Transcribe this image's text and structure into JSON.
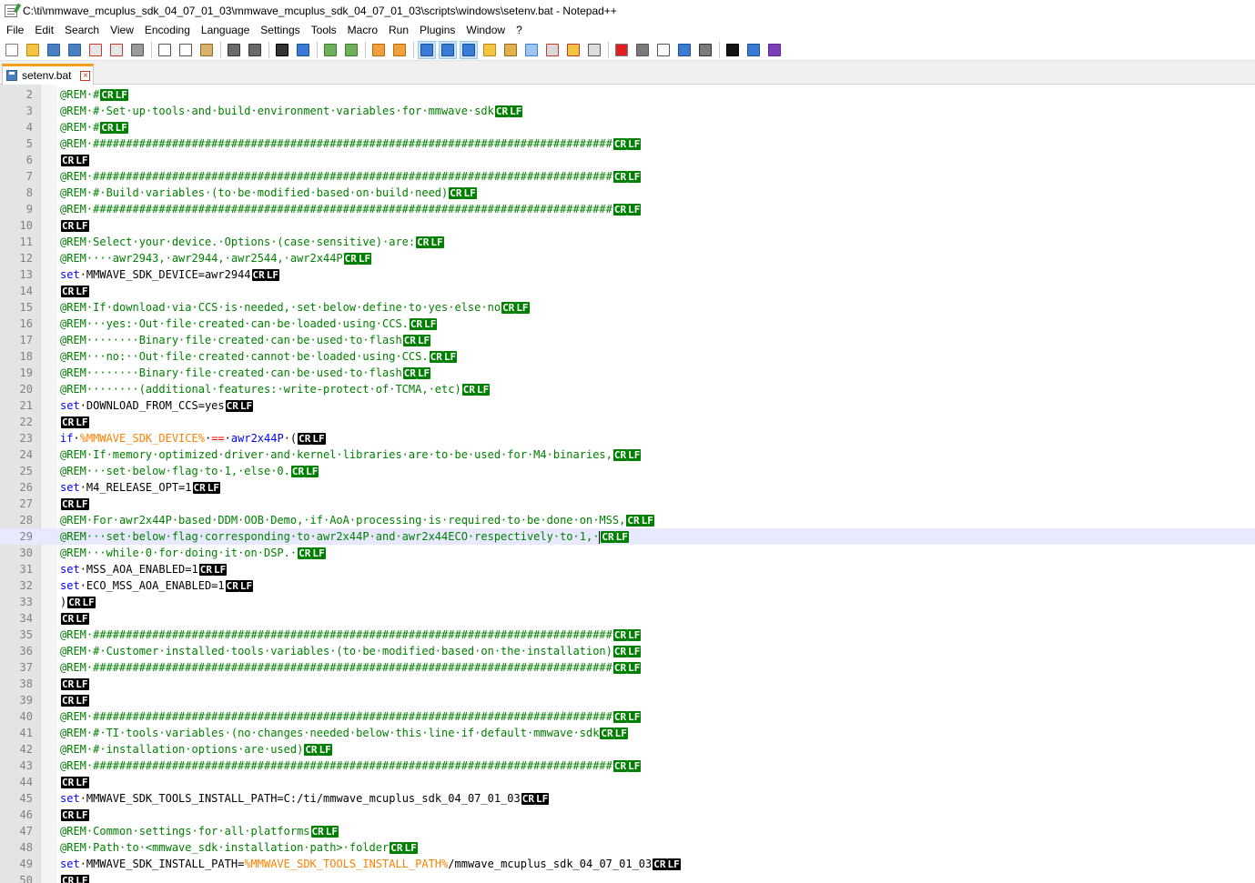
{
  "window": {
    "title": "C:\\ti\\mmwave_mcuplus_sdk_04_07_01_03\\mmwave_mcuplus_sdk_04_07_01_03\\scripts\\windows\\setenv.bat - Notepad++"
  },
  "menu": [
    "File",
    "Edit",
    "Search",
    "View",
    "Encoding",
    "Language",
    "Settings",
    "Tools",
    "Macro",
    "Run",
    "Plugins",
    "Window",
    "?"
  ],
  "toolbar": {
    "buttons": [
      {
        "icon": "new-file-icon",
        "color": "#ffffff",
        "border": "#7a7a7a"
      },
      {
        "icon": "open-file-icon",
        "color": "#f5c542",
        "border": "#b58a1a"
      },
      {
        "icon": "save-icon",
        "color": "#4a7fc1",
        "border": "#2c5d9c"
      },
      {
        "icon": "save-all-icon",
        "color": "#4a7fc1",
        "border": "#2c5d9c"
      },
      {
        "icon": "close-file-icon",
        "color": "#e6e6e6",
        "border": "#c0392b"
      },
      {
        "icon": "close-all-icon",
        "color": "#e6e6e6",
        "border": "#c0392b"
      },
      {
        "icon": "print-icon",
        "color": "#9a9a9a",
        "border": "#555555"
      },
      {
        "sep": true
      },
      {
        "icon": "cut-icon",
        "color": "#ffffff",
        "border": "#555555"
      },
      {
        "icon": "copy-icon",
        "color": "#ffffff",
        "border": "#555555"
      },
      {
        "icon": "paste-icon",
        "color": "#d9b36b",
        "border": "#8a6a2a"
      },
      {
        "sep": true
      },
      {
        "icon": "undo-icon",
        "color": "#6a6a6a",
        "border": "#333333"
      },
      {
        "icon": "redo-icon",
        "color": "#6a6a6a",
        "border": "#333333"
      },
      {
        "sep": true
      },
      {
        "icon": "find-icon",
        "color": "#333333",
        "border": "#000000"
      },
      {
        "icon": "replace-icon",
        "color": "#3a7bd5",
        "border": "#1f4f91"
      },
      {
        "sep": true
      },
      {
        "icon": "zoom-in-icon",
        "color": "#6fb05a",
        "border": "#3d7a2b"
      },
      {
        "icon": "zoom-out-icon",
        "color": "#6fb05a",
        "border": "#3d7a2b"
      },
      {
        "sep": true
      },
      {
        "icon": "sync-vertical-icon",
        "color": "#f2a03d",
        "border": "#b36b12"
      },
      {
        "icon": "sync-horizontal-icon",
        "color": "#f2a03d",
        "border": "#b36b12"
      },
      {
        "sep": true
      },
      {
        "icon": "word-wrap-icon",
        "color": "#3a7bd5",
        "border": "#1f4f91",
        "active": true
      },
      {
        "icon": "show-all-characters-icon",
        "color": "#3a7bd5",
        "border": "#1f4f91",
        "active": true
      },
      {
        "icon": "indent-guide-icon",
        "color": "#3a7bd5",
        "border": "#1f4f91",
        "active": true
      },
      {
        "icon": "user-defined-language-icon",
        "color": "#f5c542",
        "border": "#b58a1a"
      },
      {
        "icon": "document-map-icon",
        "color": "#e3b04b",
        "border": "#8a6a2a"
      },
      {
        "icon": "document-list-icon",
        "color": "#9ec5f0",
        "border": "#3a7bd5"
      },
      {
        "icon": "function-list-icon",
        "color": "#d9d9d9",
        "border": "#c0392b"
      },
      {
        "icon": "folder-as-workspace-icon",
        "color": "#f5c542",
        "border": "#c0392b"
      },
      {
        "icon": "monitoring-icon",
        "color": "#dddddd",
        "border": "#555555"
      },
      {
        "sep": true
      },
      {
        "icon": "record-macro-icon",
        "color": "#e02020",
        "border": "#7a7a7a"
      },
      {
        "icon": "stop-recording-icon",
        "color": "#7a7a7a",
        "border": "#555555"
      },
      {
        "icon": "playback-macro-icon",
        "color": "#ffffff",
        "border": "#555555"
      },
      {
        "icon": "run-macro-multiple-icon",
        "color": "#3a7bd5",
        "border": "#1f4f91"
      },
      {
        "icon": "save-macro-icon",
        "color": "#7a7a7a",
        "border": "#333333"
      },
      {
        "sep": true
      },
      {
        "icon": "markdown-preview-icon",
        "color": "#111111",
        "border": "#000000"
      },
      {
        "icon": "console-icon",
        "color": "#3a7bd5",
        "border": "#1f4f91"
      },
      {
        "icon": "markdown-panel-icon",
        "color": "#7b3fb8",
        "border": "#5a2a8a"
      }
    ]
  },
  "tab": {
    "label": "setenv.bat"
  },
  "editor": {
    "lines": [
      {
        "n": "2",
        "seg": [
          [
            "rem",
            "@REM·#"
          ]
        ],
        "eol": "green"
      },
      {
        "n": "3",
        "seg": [
          [
            "rem",
            "@REM·#·Set·up·tools·and·build·environment·variables·for·mmwave·sdk"
          ]
        ],
        "eol": "green"
      },
      {
        "n": "4",
        "seg": [
          [
            "rem",
            "@REM·#"
          ]
        ],
        "eol": "green"
      },
      {
        "n": "5",
        "seg": [
          [
            "rem",
            "@REM·###############################################################################"
          ]
        ],
        "eol": "green"
      },
      {
        "n": "6",
        "seg": [],
        "eol": "black"
      },
      {
        "n": "7",
        "seg": [
          [
            "rem",
            "@REM·###############################################################################"
          ]
        ],
        "eol": "green"
      },
      {
        "n": "8",
        "seg": [
          [
            "rem",
            "@REM·#·Build·variables·(to·be·modified·based·on·build·need)"
          ]
        ],
        "eol": "green"
      },
      {
        "n": "9",
        "seg": [
          [
            "rem",
            "@REM·###############################################################################"
          ]
        ],
        "eol": "green"
      },
      {
        "n": "10",
        "seg": [],
        "eol": "black"
      },
      {
        "n": "11",
        "seg": [
          [
            "rem",
            "@REM·Select·your·device.·Options·(case·sensitive)·are:"
          ]
        ],
        "eol": "green"
      },
      {
        "n": "12",
        "seg": [
          [
            "rem",
            "@REM····awr2943,·awr2944,·awr2544,·awr2x44P"
          ]
        ],
        "eol": "green"
      },
      {
        "n": "13",
        "seg": [
          [
            "kw",
            "set"
          ],
          [
            "txt",
            "·MMWAVE_SDK_DEVICE=awr2944"
          ]
        ],
        "eol": "black"
      },
      {
        "n": "14",
        "seg": [],
        "eol": "black"
      },
      {
        "n": "15",
        "seg": [
          [
            "rem",
            "@REM·If·download·via·CCS·is·needed,·set·below·define·to·yes·else·no"
          ]
        ],
        "eol": "green"
      },
      {
        "n": "16",
        "seg": [
          [
            "rem",
            "@REM···yes:·Out·file·created·can·be·loaded·using·CCS."
          ]
        ],
        "eol": "green"
      },
      {
        "n": "17",
        "seg": [
          [
            "rem",
            "@REM········Binary·file·created·can·be·used·to·flash"
          ]
        ],
        "eol": "green"
      },
      {
        "n": "18",
        "seg": [
          [
            "rem",
            "@REM···no:··Out·file·created·cannot·be·loaded·using·CCS."
          ]
        ],
        "eol": "green"
      },
      {
        "n": "19",
        "seg": [
          [
            "rem",
            "@REM········Binary·file·created·can·be·used·to·flash"
          ]
        ],
        "eol": "green"
      },
      {
        "n": "20",
        "seg": [
          [
            "rem",
            "@REM········(additional·features:·write-protect·of·TCMA,·etc)"
          ]
        ],
        "eol": "green"
      },
      {
        "n": "21",
        "seg": [
          [
            "kw",
            "set"
          ],
          [
            "txt",
            "·DOWNLOAD_FROM_CCS=yes"
          ]
        ],
        "eol": "black"
      },
      {
        "n": "22",
        "seg": [],
        "eol": "black"
      },
      {
        "n": "23",
        "seg": [
          [
            "kw",
            "if"
          ],
          [
            "txt",
            "·"
          ],
          [
            "var",
            "%MMWAVE_SDK_DEVICE%"
          ],
          [
            "txt",
            "·"
          ],
          [
            "op",
            "=="
          ],
          [
            "txt",
            "·"
          ],
          [
            "kw",
            "awr2x44P"
          ],
          [
            "txt",
            "·("
          ]
        ],
        "eol": "black"
      },
      {
        "n": "24",
        "seg": [
          [
            "rem",
            "@REM·If·memory·optimized·driver·and·kernel·libraries·are·to·be·used·for·M4·binaries,"
          ]
        ],
        "eol": "green"
      },
      {
        "n": "25",
        "seg": [
          [
            "rem",
            "@REM···set·below·flag·to·1,·else·0."
          ]
        ],
        "eol": "green"
      },
      {
        "n": "26",
        "seg": [
          [
            "kw",
            "set"
          ],
          [
            "txt",
            "·M4_RELEASE_OPT=1"
          ]
        ],
        "eol": "black"
      },
      {
        "n": "27",
        "seg": [],
        "eol": "black"
      },
      {
        "n": "28",
        "seg": [
          [
            "rem",
            "@REM·For·awr2x44P·based·DDM·OOB·Demo,·if·AoA·processing·is·required·to·be·done·on·MSS,"
          ]
        ],
        "eol": "green"
      },
      {
        "n": "29",
        "seg": [
          [
            "rem",
            "@REM···set·below·flag·corresponding·to·awr2x44P·and·awr2x44ECO·respectively·to·1,·"
          ]
        ],
        "eol": "green",
        "current": true
      },
      {
        "n": "30",
        "seg": [
          [
            "rem",
            "@REM···while·0·for·doing·it·on·DSP.·"
          ]
        ],
        "eol": "green"
      },
      {
        "n": "31",
        "seg": [
          [
            "kw",
            "set"
          ],
          [
            "txt",
            "·MSS_AOA_ENABLED=1"
          ]
        ],
        "eol": "black"
      },
      {
        "n": "32",
        "seg": [
          [
            "kw",
            "set"
          ],
          [
            "txt",
            "·ECO_MSS_AOA_ENABLED=1"
          ]
        ],
        "eol": "black"
      },
      {
        "n": "33",
        "seg": [
          [
            "txt",
            ")"
          ]
        ],
        "eol": "black"
      },
      {
        "n": "34",
        "seg": [],
        "eol": "black"
      },
      {
        "n": "35",
        "seg": [
          [
            "rem",
            "@REM·###############################################################################"
          ]
        ],
        "eol": "green"
      },
      {
        "n": "36",
        "seg": [
          [
            "rem",
            "@REM·#·Customer·installed·tools·variables·(to·be·modified·based·on·the·installation)"
          ]
        ],
        "eol": "green"
      },
      {
        "n": "37",
        "seg": [
          [
            "rem",
            "@REM·###############################################################################"
          ]
        ],
        "eol": "green"
      },
      {
        "n": "38",
        "seg": [],
        "eol": "black"
      },
      {
        "n": "39",
        "seg": [],
        "eol": "black"
      },
      {
        "n": "40",
        "seg": [
          [
            "rem",
            "@REM·###############################################################################"
          ]
        ],
        "eol": "green"
      },
      {
        "n": "41",
        "seg": [
          [
            "rem",
            "@REM·#·TI·tools·variables·(no·changes·needed·below·this·line·if·default·mmwave·sdk"
          ]
        ],
        "eol": "green"
      },
      {
        "n": "42",
        "seg": [
          [
            "rem",
            "@REM·#·installation·options·are·used)"
          ]
        ],
        "eol": "green"
      },
      {
        "n": "43",
        "seg": [
          [
            "rem",
            "@REM·###############################################################################"
          ]
        ],
        "eol": "green"
      },
      {
        "n": "44",
        "seg": [],
        "eol": "black"
      },
      {
        "n": "45",
        "seg": [
          [
            "kw",
            "set"
          ],
          [
            "txt",
            "·MMWAVE_SDK_TOOLS_INSTALL_PATH=C:/ti/mmwave_mcuplus_sdk_04_07_01_03"
          ]
        ],
        "eol": "black"
      },
      {
        "n": "46",
        "seg": [],
        "eol": "black"
      },
      {
        "n": "47",
        "seg": [
          [
            "rem",
            "@REM·Common·settings·for·all·platforms"
          ]
        ],
        "eol": "green"
      },
      {
        "n": "48",
        "seg": [
          [
            "rem",
            "@REM·Path·to·<mmwave_sdk·installation·path>·folder"
          ]
        ],
        "eol": "green"
      },
      {
        "n": "49",
        "seg": [
          [
            "kw",
            "set"
          ],
          [
            "txt",
            "·MMWAVE_SDK_INSTALL_PATH="
          ],
          [
            "var",
            "%MMWAVE_SDK_TOOLS_INSTALL_PATH%"
          ],
          [
            "txt",
            "/mmwave_mcuplus_sdk_04_07_01_03"
          ]
        ],
        "eol": "black"
      },
      {
        "n": "50",
        "seg": [],
        "eol": "black"
      }
    ],
    "eol_labels": [
      "CR",
      "LF"
    ],
    "colors": {
      "comment": "#008000",
      "keyword": "#0000ff",
      "variable": "#ff8000",
      "operator": "#ff0000",
      "line_number": "#808080",
      "current_line": "#e8e8ff"
    }
  }
}
